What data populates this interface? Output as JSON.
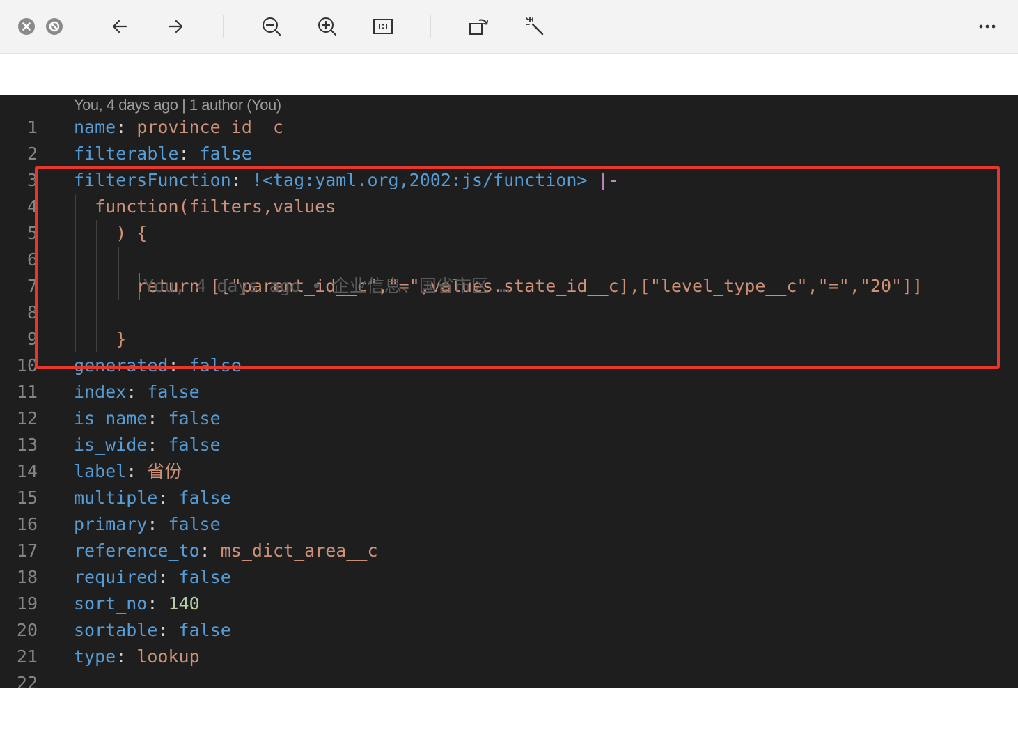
{
  "toolbar": {
    "buttons": [
      {
        "name": "close-icon"
      },
      {
        "name": "stop-icon"
      },
      {
        "name": "back-arrow-icon"
      },
      {
        "name": "forward-arrow-icon"
      },
      {
        "name": "zoom-out-icon"
      },
      {
        "name": "zoom-in-icon"
      },
      {
        "name": "actual-size-icon",
        "label": "1:1"
      },
      {
        "name": "rotate-icon"
      },
      {
        "name": "magic-wand-icon"
      },
      {
        "name": "more-icon"
      }
    ]
  },
  "editor": {
    "blame_header": "You, 4 days ago | 1 author (You)",
    "ghost_blame": "You, 4 days ago • 企业信息、国省市区 …",
    "highlight_color": "#e5372b",
    "lines": [
      {
        "no": "1",
        "key": "name",
        "sep": ": ",
        "val": "province_id__c",
        "vt": "s"
      },
      {
        "no": "2",
        "key": "filterable",
        "sep": ": ",
        "val": "false",
        "vt": "k"
      },
      {
        "no": "3",
        "key": "filtersFunction",
        "sep": ": ",
        "val": "!<tag:yaml.org,2002:js/function>",
        "vt": "k",
        "extra": " |-"
      },
      {
        "no": "4",
        "code": "  function(filters,values"
      },
      {
        "no": "5",
        "code": "    ) {"
      },
      {
        "no": "6",
        "code": ""
      },
      {
        "no": "7",
        "code": "      return [[\"parent_id__c\",\"=\",values.state_id__c],[\"level_type__c\",\"=\",\"20\"]]"
      },
      {
        "no": "8",
        "code": ""
      },
      {
        "no": "9",
        "code": "    }"
      },
      {
        "no": "10",
        "key": "generated",
        "sep": ": ",
        "val": "false",
        "vt": "k"
      },
      {
        "no": "11",
        "key": "index",
        "sep": ": ",
        "val": "false",
        "vt": "k"
      },
      {
        "no": "12",
        "key": "is_name",
        "sep": ": ",
        "val": "false",
        "vt": "k"
      },
      {
        "no": "13",
        "key": "is_wide",
        "sep": ": ",
        "val": "false",
        "vt": "k"
      },
      {
        "no": "14",
        "key": "label",
        "sep": ": ",
        "val": "省份",
        "vt": "s"
      },
      {
        "no": "15",
        "key": "multiple",
        "sep": ": ",
        "val": "false",
        "vt": "k"
      },
      {
        "no": "16",
        "key": "primary",
        "sep": ": ",
        "val": "false",
        "vt": "k"
      },
      {
        "no": "17",
        "key": "reference_to",
        "sep": ": ",
        "val": "ms_dict_area__c",
        "vt": "s"
      },
      {
        "no": "18",
        "key": "required",
        "sep": ": ",
        "val": "false",
        "vt": "k"
      },
      {
        "no": "19",
        "key": "sort_no",
        "sep": ": ",
        "val": "140",
        "vt": "n"
      },
      {
        "no": "20",
        "key": "sortable",
        "sep": ": ",
        "val": "false",
        "vt": "k"
      },
      {
        "no": "21",
        "key": "type",
        "sep": ": ",
        "val": "lookup",
        "vt": "s"
      },
      {
        "no": "22",
        "code": ""
      }
    ]
  }
}
